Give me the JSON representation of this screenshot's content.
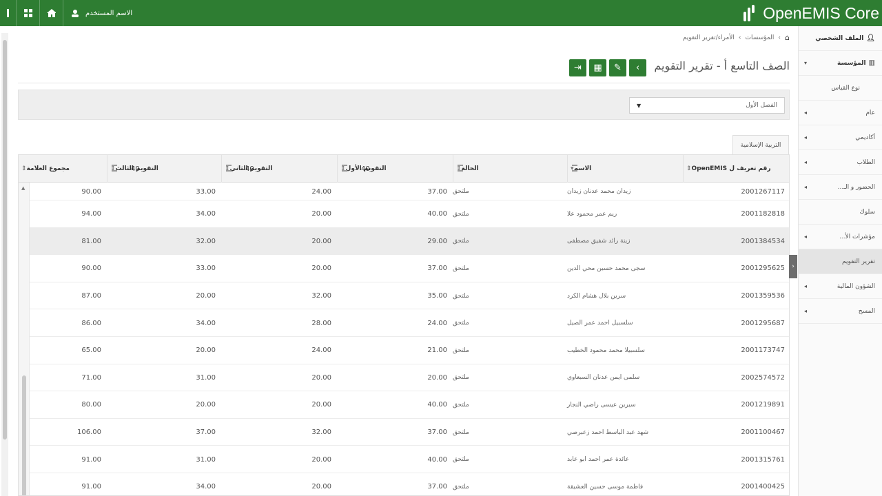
{
  "topbar": {
    "user_name": "الاسم المستخدم",
    "brand": "OpenEMIS Core",
    "icons": [
      "sidebar-toggle-icon",
      "grid-icon",
      "home-icon",
      "user-icon"
    ]
  },
  "breadcrumb": {
    "home_icon": "home-icon",
    "items": [
      "المؤسسات",
      "الأمراء/تقرير التقويم"
    ]
  },
  "page_title": "الصف التاسع أ - تقرير التقويم",
  "actions": [
    {
      "name": "back-button",
      "glyph": "‹"
    },
    {
      "name": "edit-button",
      "glyph": "✎"
    },
    {
      "name": "calculator-button",
      "glyph": "▦"
    },
    {
      "name": "export-button",
      "glyph": "⇥"
    }
  ],
  "filter": {
    "selected": "الفصل الأول"
  },
  "subject_tab": "التربية الإسلامية",
  "table": {
    "headers": {
      "openemis_id": "رقم تعريف ل OpenEMIS",
      "name": "الاسم",
      "status": "الحالة",
      "assessment_1": "التقويم الأول",
      "assessment_2": "التقويم الثاني",
      "assessment_3": "التقويم الثالث",
      "total": "مجموع العلامة"
    },
    "max_marks": {
      "assessment_1": "40",
      "assessment_2": "40",
      "assessment_3": "40"
    },
    "rows": [
      {
        "id": "2001267117",
        "name": "زيدان محمد عدنان زيدان",
        "status": "ملتحق",
        "a1": "37.00",
        "a2": "24.00",
        "a3": "33.00",
        "total": "90.00"
      },
      {
        "id": "2001182818",
        "name": "ريم عمر محمود علا",
        "status": "ملتحق",
        "a1": "40.00",
        "a2": "20.00",
        "a3": "34.00",
        "total": "94.00"
      },
      {
        "id": "2001384534",
        "name": "زينة رائد شفيق مصطفى",
        "status": "ملتحق",
        "a1": "29.00",
        "a2": "20.00",
        "a3": "32.00",
        "total": "81.00"
      },
      {
        "id": "2001295625",
        "name": "سجى محمد حسين محي الدين",
        "status": "ملتحق",
        "a1": "37.00",
        "a2": "20.00",
        "a3": "33.00",
        "total": "90.00"
      },
      {
        "id": "2001359536",
        "name": "سرين بلال هشام الكرد",
        "status": "ملتحق",
        "a1": "35.00",
        "a2": "32.00",
        "a3": "20.00",
        "total": "87.00"
      },
      {
        "id": "2001295687",
        "name": "سلسبيل احمد عمر الصيل",
        "status": "ملتحق",
        "a1": "24.00",
        "a2": "28.00",
        "a3": "34.00",
        "total": "86.00"
      },
      {
        "id": "2001173747",
        "name": "سلسبيلا محمد محمود الخطيب",
        "status": "ملتحق",
        "a1": "21.00",
        "a2": "24.00",
        "a3": "20.00",
        "total": "65.00"
      },
      {
        "id": "2002574572",
        "name": "سلمى ايمن عدنان السبعاوي",
        "status": "ملتحق",
        "a1": "20.00",
        "a2": "20.00",
        "a3": "31.00",
        "total": "71.00"
      },
      {
        "id": "2001219891",
        "name": "سيرين عيسى راضي النجار",
        "status": "ملتحق",
        "a1": "40.00",
        "a2": "20.00",
        "a3": "20.00",
        "total": "80.00"
      },
      {
        "id": "2001100467",
        "name": "شهد عبد الباسط احمد زعبرصي",
        "status": "ملتحق",
        "a1": "37.00",
        "a2": "32.00",
        "a3": "37.00",
        "total": "106.00"
      },
      {
        "id": "2001315761",
        "name": "عائدة عمر احمد ابو عابد",
        "status": "ملتحق",
        "a1": "40.00",
        "a2": "20.00",
        "a3": "31.00",
        "total": "91.00"
      },
      {
        "id": "2001400425",
        "name": "فاطمة موسى حسين العشيقة",
        "status": "ملتحق",
        "a1": "37.00",
        "a2": "20.00",
        "a3": "34.00",
        "total": "91.00"
      }
    ]
  },
  "sidebar": {
    "profile": "الملف الشخصي",
    "institution": "المؤسسة",
    "items": [
      {
        "label": "نوع القياس",
        "chevron": false,
        "sub": true
      },
      {
        "label": "عام",
        "chevron": true
      },
      {
        "label": "أكاديمي",
        "chevron": true
      },
      {
        "label": "الطلاب",
        "chevron": true
      },
      {
        "label": "الحضور و الـ...",
        "chevron": true
      },
      {
        "label": "سلوك",
        "chevron": false
      },
      {
        "label": "مؤشرات الأ...",
        "chevron": true
      },
      {
        "label": "تقرير التقويم",
        "chevron": false,
        "active": true
      },
      {
        "label": "الشؤون المالية",
        "chevron": true
      },
      {
        "label": "المسح",
        "chevron": true
      }
    ]
  }
}
